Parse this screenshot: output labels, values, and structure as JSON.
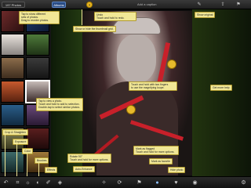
{
  "topbar": {
    "back_label": "197 Photos",
    "albums_label": "Albums",
    "help_label": "?",
    "title": "Add a caption",
    "icons": [
      "brush-icon",
      "share-icon",
      "flag-icon"
    ]
  },
  "bottombar": {
    "icons": [
      "undo-icon",
      "rotate-icon",
      "crop-icon",
      "color-icon",
      "brushes-icon",
      "effects-icon",
      "wand-icon",
      "compare-icon",
      "flag-icon",
      "heart-icon",
      "eye-icon",
      "gear-icon"
    ]
  },
  "tooltips": {
    "swipe": "Tap to show different\nsets of photos.\nDrag to reorder photos.",
    "grid": "Show or hide the thumbnail grid.",
    "undo": "Undo\nTouch and hold to redo.",
    "show_original": "Show original",
    "magnifier": "Touch and hold with two fingers\nto use the magnifying loupe.",
    "more_help": "Get more help",
    "select_photo": "Tap to view a photo.\nTouch and hold to add to selection.\nDouble-tap to select similar photos.",
    "crop": "Crop & Straighten",
    "exposure": "Exposure",
    "color": "Color",
    "brushes": "Brushes",
    "effects": "Effects",
    "rotate": "Rotate 90°\nTouch and hold for more options.",
    "auto_enhance": "Auto-Enhance",
    "flagged": "Mark as flagged\nTouch and hold for more options.",
    "favorite": "Mark as favorite",
    "hide": "Hide photo"
  }
}
